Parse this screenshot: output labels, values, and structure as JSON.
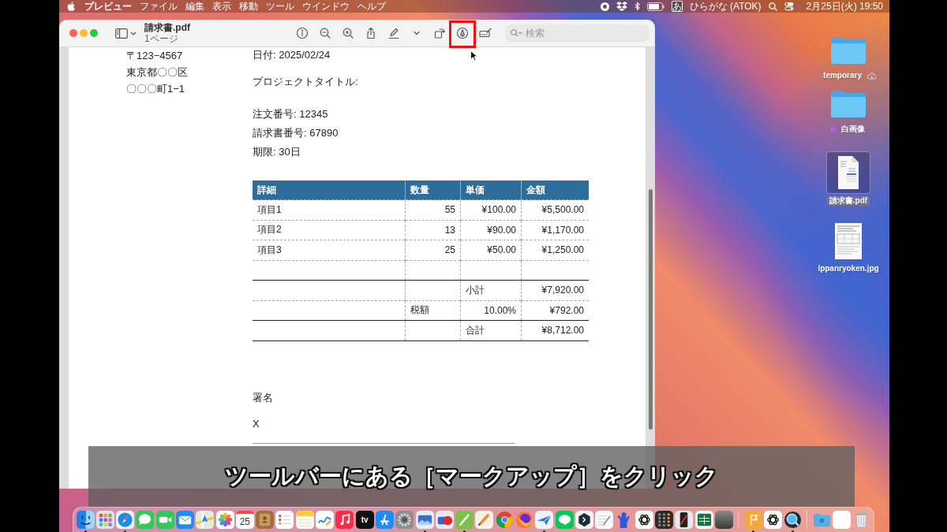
{
  "menu_bar": {
    "menus": [
      {
        "label": "プレビュー",
        "kind": "app"
      },
      {
        "label": "ファイル",
        "kind": "menu"
      },
      {
        "label": "編集",
        "kind": "menu"
      },
      {
        "label": "表示",
        "kind": "menu"
      },
      {
        "label": "移動",
        "kind": "menu"
      },
      {
        "label": "ツール",
        "kind": "menu"
      },
      {
        "label": "ウインドウ",
        "kind": "menu"
      },
      {
        "label": "ヘルプ",
        "kind": "menu"
      }
    ],
    "input_badge": "あ",
    "input_mode": "ひらがな (ATOK)",
    "clock": "2月25日(火) 19:50"
  },
  "window": {
    "title": "請求書.pdf",
    "subtitle": "1ページ",
    "tools": [
      {
        "kind": "info",
        "highlighted": false
      },
      {
        "kind": "zoomout",
        "highlighted": false
      },
      {
        "kind": "zoomin",
        "highlighted": false
      },
      {
        "kind": "share",
        "highlighted": false
      },
      {
        "kind": "pen",
        "highlighted": false
      },
      {
        "kind": "chevron",
        "highlighted": false
      },
      {
        "kind": "rotate",
        "highlighted": false
      },
      {
        "kind": "markup",
        "highlighted": true
      },
      {
        "kind": "form",
        "highlighted": false
      }
    ],
    "search": {
      "placeholder": "検索"
    }
  },
  "document": {
    "address": [
      "〒123−4567",
      "東京都〇〇区",
      "〇〇〇町1−1"
    ],
    "details": [
      "日付: 2025/02/24",
      "プロジェクトタイトル:",
      "注文番号: 12345",
      "請求書番号: 67890",
      "期限: 30日"
    ],
    "table": {
      "columns": [
        "詳細",
        "数量",
        "単価",
        "金額"
      ],
      "rows": [
        {
          "kind": "item",
          "cells": [
            "項目1",
            "55",
            "¥100.00",
            "¥5,500.00"
          ]
        },
        {
          "kind": "item",
          "cells": [
            "項目2",
            "13",
            "¥90.00",
            "¥1,170.00"
          ]
        },
        {
          "kind": "item",
          "cells": [
            "項目3",
            "25",
            "¥50.00",
            "¥1,250.00"
          ]
        },
        {
          "kind": "blank"
        },
        {
          "kind": "subtotal",
          "label": "小計",
          "amount": "¥7,920.00"
        },
        {
          "kind": "tax",
          "label": "税額",
          "rate": "10.00%",
          "amount": "¥792.00"
        },
        {
          "kind": "total",
          "label": "合計",
          "amount": "¥8,712.00"
        }
      ]
    },
    "signature_label": "署名",
    "signature_mark": "X"
  },
  "desktop": {
    "items": [
      {
        "kind": "folder",
        "label": "temporary",
        "cloud": true,
        "selected": false
      },
      {
        "kind": "folder",
        "label": "白画像",
        "color": "#b35ee6",
        "cloud": false,
        "selected": false
      },
      {
        "kind": "pdf",
        "label": "請求書.pdf",
        "cloud": false,
        "selected": true
      },
      {
        "kind": "image",
        "label": "ippanryoken.jpg",
        "cloud": false,
        "selected": false
      }
    ]
  },
  "dock": {
    "items": [
      {
        "kind": "finder",
        "running": true
      },
      {
        "kind": "launchpad",
        "running": false
      },
      {
        "kind": "safari",
        "running": true
      },
      {
        "kind": "messages",
        "running": false
      },
      {
        "kind": "facetime",
        "running": false
      },
      {
        "kind": "mail",
        "running": false
      },
      {
        "kind": "maps",
        "running": false
      },
      {
        "kind": "photos",
        "running": false
      },
      {
        "kind": "calendar",
        "text": "25",
        "running": false
      },
      {
        "kind": "contacts",
        "running": false
      },
      {
        "kind": "reminders",
        "running": false
      },
      {
        "kind": "notes",
        "running": false
      },
      {
        "kind": "freeform",
        "running": false
      },
      {
        "kind": "music",
        "running": false
      },
      {
        "kind": "tv",
        "text": "tv",
        "running": false
      },
      {
        "kind": "appstore",
        "running": false
      },
      {
        "kind": "settings",
        "running": false
      },
      {
        "kind": "viewer",
        "running": true
      },
      {
        "kind": "shapes",
        "running": false
      },
      {
        "kind": "slash",
        "running": true
      },
      {
        "kind": "brush",
        "running": false
      },
      {
        "kind": "wheel",
        "running": false
      },
      {
        "kind": "globe",
        "running": false
      },
      {
        "kind": "airplane",
        "running": true
      },
      {
        "kind": "chat",
        "running": false
      },
      {
        "kind": "hexagon",
        "running": false
      },
      {
        "kind": "memo",
        "running": false
      },
      {
        "kind": "hand",
        "running": false
      },
      {
        "kind": "knot",
        "running": false
      },
      {
        "kind": "calculator",
        "running": false
      },
      {
        "kind": "phone",
        "running": false
      },
      {
        "kind": "spreadsheet",
        "running": false
      },
      {
        "kind": "photo",
        "running": false
      },
      {
        "kind": "separator"
      },
      {
        "kind": "flag",
        "running": true
      },
      {
        "kind": "knot",
        "running": false
      },
      {
        "kind": "lens",
        "running": true
      },
      {
        "kind": "separator"
      },
      {
        "kind": "folder",
        "running": false
      },
      {
        "kind": "blank",
        "running": false
      },
      {
        "kind": "trash",
        "running": false
      }
    ]
  },
  "caption": "ツールバーにある［マークアップ］をクリック"
}
